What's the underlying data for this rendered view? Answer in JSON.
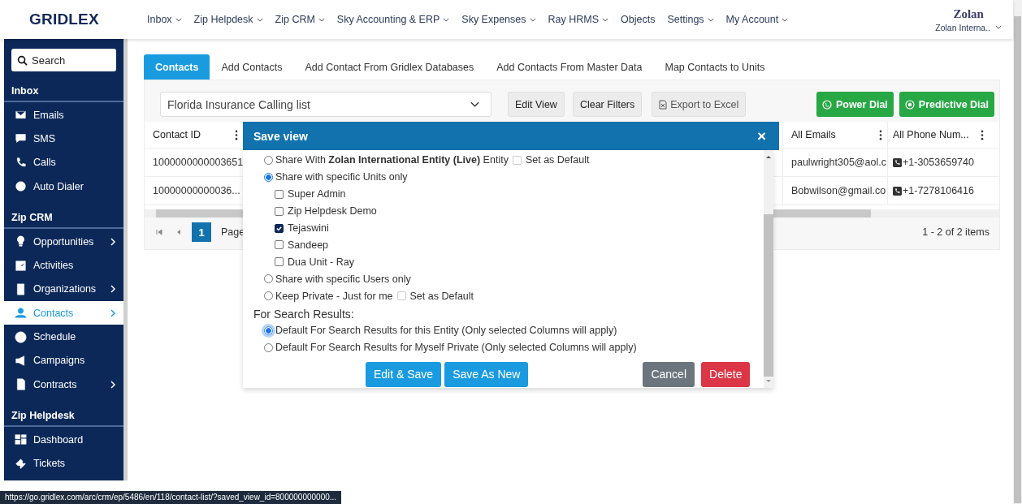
{
  "header": {
    "logo": "GRIDLEX",
    "nav": [
      {
        "label": "Inbox",
        "has_menu": true
      },
      {
        "label": "Zip Helpdesk",
        "has_menu": true
      },
      {
        "label": "Zip CRM",
        "has_menu": true
      },
      {
        "label": "Sky Accounting & ERP",
        "has_menu": true
      },
      {
        "label": "Sky Expenses",
        "has_menu": true
      },
      {
        "label": "Ray HRMS",
        "has_menu": true
      },
      {
        "label": "Objects",
        "has_menu": false
      },
      {
        "label": "Settings",
        "has_menu": true
      },
      {
        "label": "My Account",
        "has_menu": true
      }
    ],
    "user": {
      "name": "Zolan",
      "entity": "Zolan Interna.."
    }
  },
  "sidebar": {
    "search": {
      "placeholder": "Search"
    },
    "sections": [
      {
        "title": "Inbox",
        "items": [
          {
            "label": "Emails",
            "has_submenu": false,
            "selected": false
          },
          {
            "label": "SMS",
            "has_submenu": false,
            "selected": false
          },
          {
            "label": "Calls",
            "has_submenu": false,
            "selected": false
          },
          {
            "label": "Auto Dialer",
            "has_submenu": false,
            "selected": false
          }
        ]
      },
      {
        "title": "Zip CRM",
        "items": [
          {
            "label": "Opportunities",
            "has_submenu": true,
            "selected": false
          },
          {
            "label": "Activities",
            "has_submenu": false,
            "selected": false
          },
          {
            "label": "Organizations",
            "has_submenu": true,
            "selected": false
          },
          {
            "label": "Contacts",
            "has_submenu": true,
            "selected": true
          },
          {
            "label": "Schedule",
            "has_submenu": false,
            "selected": false
          },
          {
            "label": "Campaigns",
            "has_submenu": false,
            "selected": false
          },
          {
            "label": "Contracts",
            "has_submenu": true,
            "selected": false
          }
        ]
      },
      {
        "title": "Zip Helpdesk",
        "items": [
          {
            "label": "Dashboard",
            "has_submenu": false,
            "selected": false
          },
          {
            "label": "Tickets",
            "has_submenu": false,
            "selected": false
          }
        ]
      }
    ]
  },
  "tabs": [
    {
      "label": "Contacts",
      "selected": true
    },
    {
      "label": "Add Contacts",
      "selected": false
    },
    {
      "label": "Add Contact From Gridlex Databases",
      "selected": false
    },
    {
      "label": "Add Contacts From Master Data",
      "selected": false
    },
    {
      "label": "Map Contacts to Units",
      "selected": false
    }
  ],
  "toolbar": {
    "view_select": {
      "value": "Florida Insurance Calling list"
    },
    "buttons": [
      {
        "label": "Edit View",
        "kind": "plain"
      },
      {
        "label": "Clear Filters",
        "kind": "plain"
      },
      {
        "label": "Export to Excel",
        "kind": "export"
      }
    ],
    "dial_buttons": [
      {
        "label": "Power Dial",
        "kind": "power"
      },
      {
        "label": "Predictive Dial",
        "kind": "predictive"
      }
    ]
  },
  "table": {
    "columns": [
      {
        "label": "Contact ID"
      },
      {
        "label": "All Emails"
      },
      {
        "label": "All Phone Num..."
      }
    ],
    "rows": [
      [
        "1000000000003651",
        "paulwright305@aol.c",
        "+1-3053659740"
      ],
      [
        "10000000000036...",
        "Bobwilson@gmail.co",
        "+1-7278106416"
      ]
    ],
    "pager": {
      "page": "1",
      "page_label": "Page",
      "summary": "1 - 2 of 2 items"
    }
  },
  "modal": {
    "title": "Save view",
    "close": "×",
    "share_options": [
      {
        "label": "Share With **Zolan International Entity (Live)** Entity",
        "selected": false,
        "default_checkbox": {
          "label": "Set as Default",
          "checked": false
        }
      },
      {
        "label": "Share with specific Units only",
        "selected": true,
        "units": [
          {
            "label": "Super Admin",
            "checked": false
          },
          {
            "label": "Zip Helpdesk Demo",
            "checked": false
          },
          {
            "label": "Tejaswini",
            "checked": true
          },
          {
            "label": "Sandeep",
            "checked": false
          },
          {
            "label": "Dua Unit - Ray",
            "checked": false
          }
        ]
      },
      {
        "label": "Share with specific Users only",
        "selected": false
      },
      {
        "label": "Keep Private - Just for me",
        "selected": false,
        "default_checkbox": {
          "label": "Set as Default",
          "checked": false
        }
      }
    ],
    "search_heading": "For Search Results:",
    "search_options": [
      {
        "label": "Default For Search Results for this Entity (Only selected Columns will apply)",
        "selected": true
      },
      {
        "label": "Default For Search Results for Myself Private (Only selected Columns will apply)",
        "selected": false
      }
    ],
    "buttons": [
      {
        "label": "Edit & Save",
        "kind": "primary"
      },
      {
        "label": "Save As New",
        "kind": "primary"
      },
      {
        "label": "Cancel",
        "kind": "secondary"
      },
      {
        "label": "Delete",
        "kind": "danger"
      }
    ]
  },
  "status_bar": {
    "url": "https://go.gridlex.com/arc/crm/ep/5486/en/118/contact-list/?saved_view_id=800000000000..."
  }
}
